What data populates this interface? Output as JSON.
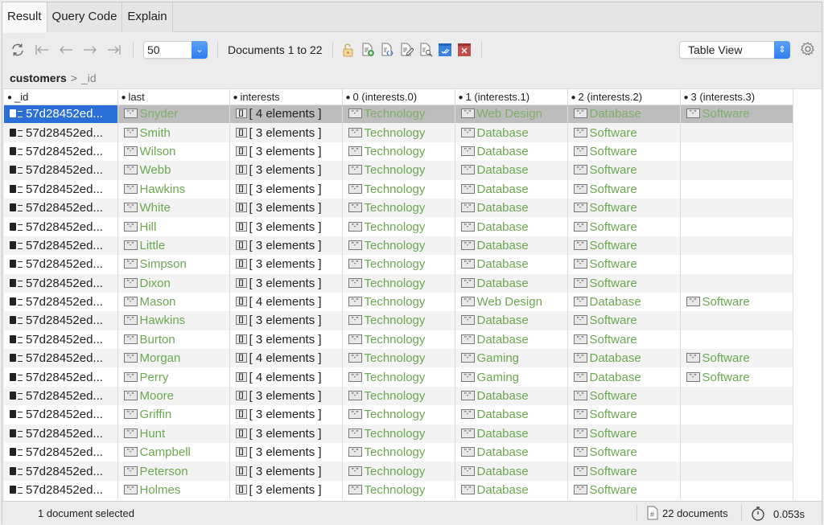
{
  "tabs": [
    {
      "label": "Result",
      "active": true
    },
    {
      "label": "Query Code",
      "active": false
    },
    {
      "label": "Explain",
      "active": false
    }
  ],
  "toolbar": {
    "refresh_icon": "refresh-icon",
    "nav_icons": [
      "first-page-icon",
      "prev-page-icon",
      "next-page-icon",
      "last-page-icon"
    ],
    "page_size": "50",
    "documents_range": "Documents 1 to 22",
    "action_icons": [
      "lock-icon",
      "add-document-icon",
      "edit-json-icon",
      "edit-document-icon",
      "view-document-icon",
      "save-changes-icon",
      "delete-document-icon"
    ],
    "view_mode": "Table View",
    "settings_icon": "gear-icon"
  },
  "breadcrumb": {
    "collection": "customers",
    "field": "_id"
  },
  "table": {
    "columns": [
      "_id",
      "last",
      "interests",
      "0 (interests.0)",
      "1 (interests.1)",
      "2 (interests.2)",
      "3 (interests.3)"
    ],
    "selected_row": 0,
    "rows": [
      {
        "id": "57d28452ed...",
        "last": "Snyder",
        "interests": "[ 4 elements ]",
        "i0": "Technology",
        "i1": "Web Design",
        "i2": "Database",
        "i3": "Software"
      },
      {
        "id": "57d28452ed...",
        "last": "Smith",
        "interests": "[ 3 elements ]",
        "i0": "Technology",
        "i1": "Database",
        "i2": "Software",
        "i3": ""
      },
      {
        "id": "57d28452ed...",
        "last": "Wilson",
        "interests": "[ 3 elements ]",
        "i0": "Technology",
        "i1": "Database",
        "i2": "Software",
        "i3": ""
      },
      {
        "id": "57d28452ed...",
        "last": "Webb",
        "interests": "[ 3 elements ]",
        "i0": "Technology",
        "i1": "Database",
        "i2": "Software",
        "i3": ""
      },
      {
        "id": "57d28452ed...",
        "last": "Hawkins",
        "interests": "[ 3 elements ]",
        "i0": "Technology",
        "i1": "Database",
        "i2": "Software",
        "i3": ""
      },
      {
        "id": "57d28452ed...",
        "last": "White",
        "interests": "[ 3 elements ]",
        "i0": "Technology",
        "i1": "Database",
        "i2": "Software",
        "i3": ""
      },
      {
        "id": "57d28452ed...",
        "last": "Hill",
        "interests": "[ 3 elements ]",
        "i0": "Technology",
        "i1": "Database",
        "i2": "Software",
        "i3": ""
      },
      {
        "id": "57d28452ed...",
        "last": "Little",
        "interests": "[ 3 elements ]",
        "i0": "Technology",
        "i1": "Database",
        "i2": "Software",
        "i3": ""
      },
      {
        "id": "57d28452ed...",
        "last": "Simpson",
        "interests": "[ 3 elements ]",
        "i0": "Technology",
        "i1": "Database",
        "i2": "Software",
        "i3": ""
      },
      {
        "id": "57d28452ed...",
        "last": "Dixon",
        "interests": "[ 3 elements ]",
        "i0": "Technology",
        "i1": "Database",
        "i2": "Software",
        "i3": ""
      },
      {
        "id": "57d28452ed...",
        "last": "Mason",
        "interests": "[ 4 elements ]",
        "i0": "Technology",
        "i1": "Web Design",
        "i2": "Database",
        "i3": "Software"
      },
      {
        "id": "57d28452ed...",
        "last": "Hawkins",
        "interests": "[ 3 elements ]",
        "i0": "Technology",
        "i1": "Database",
        "i2": "Software",
        "i3": ""
      },
      {
        "id": "57d28452ed...",
        "last": "Burton",
        "interests": "[ 3 elements ]",
        "i0": "Technology",
        "i1": "Database",
        "i2": "Software",
        "i3": ""
      },
      {
        "id": "57d28452ed...",
        "last": "Morgan",
        "interests": "[ 4 elements ]",
        "i0": "Technology",
        "i1": "Gaming",
        "i2": "Database",
        "i3": "Software"
      },
      {
        "id": "57d28452ed...",
        "last": "Perry",
        "interests": "[ 4 elements ]",
        "i0": "Technology",
        "i1": "Gaming",
        "i2": "Database",
        "i3": "Software"
      },
      {
        "id": "57d28452ed...",
        "last": "Moore",
        "interests": "[ 3 elements ]",
        "i0": "Technology",
        "i1": "Database",
        "i2": "Software",
        "i3": ""
      },
      {
        "id": "57d28452ed...",
        "last": "Griffin",
        "interests": "[ 3 elements ]",
        "i0": "Technology",
        "i1": "Database",
        "i2": "Software",
        "i3": ""
      },
      {
        "id": "57d28452ed...",
        "last": "Hunt",
        "interests": "[ 3 elements ]",
        "i0": "Technology",
        "i1": "Database",
        "i2": "Software",
        "i3": ""
      },
      {
        "id": "57d28452ed...",
        "last": "Campbell",
        "interests": "[ 3 elements ]",
        "i0": "Technology",
        "i1": "Database",
        "i2": "Software",
        "i3": ""
      },
      {
        "id": "57d28452ed...",
        "last": "Peterson",
        "interests": "[ 3 elements ]",
        "i0": "Technology",
        "i1": "Database",
        "i2": "Software",
        "i3": ""
      },
      {
        "id": "57d28452ed...",
        "last": "Holmes",
        "interests": "[ 3 elements ]",
        "i0": "Technology",
        "i1": "Database",
        "i2": "Software",
        "i3": ""
      }
    ]
  },
  "status": {
    "selection": "1 document selected",
    "count": "22 documents",
    "elapsed": "0.053s"
  },
  "colors": {
    "string_value": "#6aa84f",
    "selection_blue": "#2a6fd8",
    "selected_row": "#bdbdbd"
  }
}
